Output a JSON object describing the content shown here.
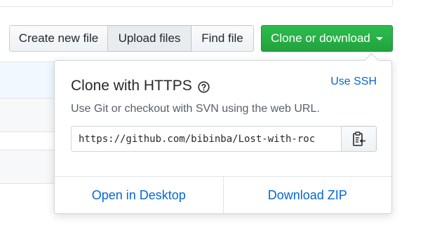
{
  "toolbar": {
    "create_label": "Create new file",
    "upload_label": "Upload files",
    "find_label": "Find file",
    "clone_label": "Clone or download"
  },
  "clone_popover": {
    "title": "Clone with HTTPS",
    "help_icon": "question-circle-icon",
    "use_ssh_label": "Use SSH",
    "description": "Use Git or checkout with SVN using the web URL.",
    "url_value": "https://github.com/bibinba/Lost-with-roc",
    "copy_icon": "clipboard-icon",
    "open_desktop_label": "Open in Desktop",
    "download_zip_label": "Download ZIP"
  },
  "colors": {
    "primary_green": "#2cbe4e",
    "link_blue": "#0366d6",
    "text_dark": "#24292e",
    "text_muted": "#586069"
  }
}
